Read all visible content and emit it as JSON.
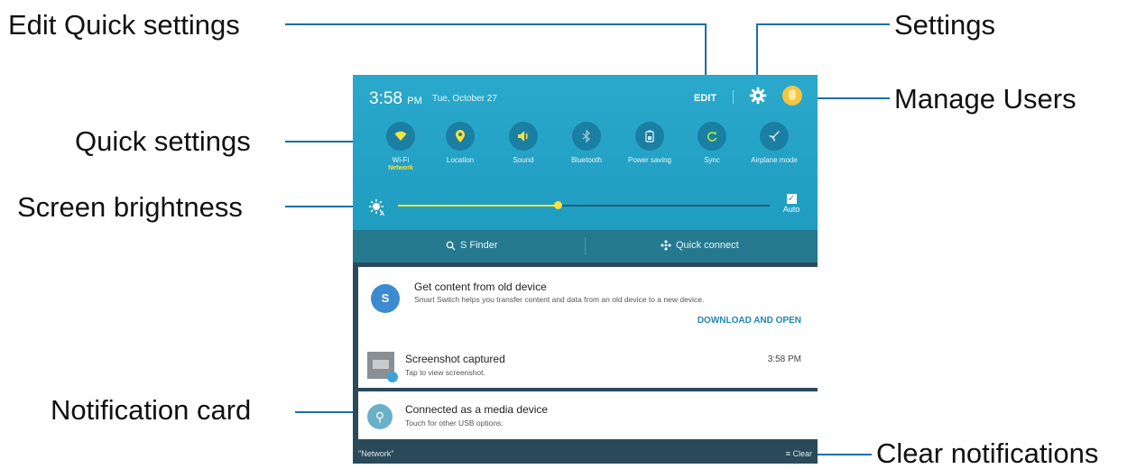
{
  "callouts": {
    "edit_quick_settings": "Edit Quick settings",
    "settings": "Settings",
    "manage_users": "Manage Users",
    "quick_settings": "Quick settings",
    "screen_brightness": "Screen brightness",
    "notification_card": "Notification card",
    "clear_notifications": "Clear notifications"
  },
  "status": {
    "time": "3:58",
    "ampm": "PM",
    "date": "Tue, October 27",
    "edit_label": "EDIT"
  },
  "quick_settings": [
    {
      "label": "Wi-Fi",
      "sub": "Network",
      "icon": "wifi-icon"
    },
    {
      "label": "Location",
      "sub": "",
      "icon": "location-icon"
    },
    {
      "label": "Sound",
      "sub": "",
      "icon": "sound-icon"
    },
    {
      "label": "Bluetooth",
      "sub": "",
      "icon": "bluetooth-icon"
    },
    {
      "label": "Power saving",
      "sub": "",
      "icon": "battery-icon"
    },
    {
      "label": "Sync",
      "sub": "",
      "icon": "sync-icon"
    },
    {
      "label": "Airplane mode",
      "sub": "",
      "icon": "airplane-icon"
    }
  ],
  "brightness": {
    "level": 0.43,
    "auto_label": "Auto",
    "auto_checked": true
  },
  "actions": {
    "s_finder": "S Finder",
    "quick_connect": "Quick connect"
  },
  "notifications": [
    {
      "badge": "S",
      "title": "Get content from old device",
      "desc": "Smart Switch helps you transfer content and data from an old device to a new device.",
      "action": "DOWNLOAD AND OPEN"
    },
    {
      "title": "Screenshot captured",
      "desc": "Tap to view screenshot.",
      "time": "3:58 PM"
    },
    {
      "title": "Connected as a media device",
      "desc": "Touch for other USB options."
    }
  ],
  "footer": {
    "network": "\"Network\"",
    "clear": "Clear"
  },
  "colors": {
    "header": "#1f9dc0",
    "accent_yellow": "#f8e23c",
    "callout_line": "#1a6fa8"
  }
}
